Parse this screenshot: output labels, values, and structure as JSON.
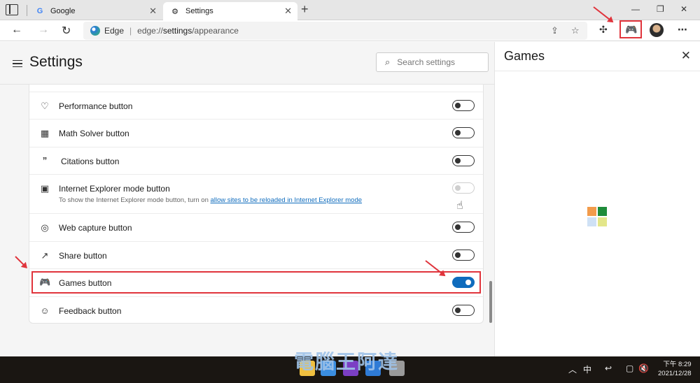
{
  "tabs": [
    {
      "label": "Google",
      "favicon": "google-icon"
    },
    {
      "label": "Settings",
      "favicon": "gear-icon"
    }
  ],
  "address": {
    "brand": "Edge",
    "url_prefix": "edge://",
    "url_host": "settings",
    "url_path": "/appearance"
  },
  "settings": {
    "title": "Settings",
    "search_placeholder": "Search settings",
    "rows": [
      {
        "icon": "heart-pulse-icon",
        "label": "Performance button",
        "state": "off"
      },
      {
        "icon": "calculator-icon",
        "label": "Math Solver button",
        "state": "off"
      },
      {
        "icon": "quote-icon",
        "label": "Citations button",
        "state": "off"
      },
      {
        "icon": "ie-mode-icon",
        "label": "Internet Explorer mode button",
        "state": "disabled",
        "sub_prefix": "To show the Internet Explorer mode button, turn on ",
        "sub_link": "allow sites to be reloaded in Internet Explorer mode"
      },
      {
        "icon": "web-capture-icon",
        "label": "Web capture button",
        "state": "off"
      },
      {
        "icon": "share-icon",
        "label": "Share button",
        "state": "off"
      },
      {
        "icon": "gamepad-icon",
        "label": "Games button",
        "state": "on"
      },
      {
        "icon": "feedback-icon",
        "label": "Feedback button",
        "state": "off"
      }
    ]
  },
  "games_pane": {
    "title": "Games",
    "logo_colors": [
      "#f29b4b",
      "#1e8c3a",
      "#cfe1f5",
      "#e3e68a"
    ]
  },
  "taskbar": {
    "ime_label": "中",
    "clock_period": "下午",
    "clock_time": "8:29",
    "clock_date": "2021/12/28"
  },
  "colors": {
    "accent": "#0f6cbd",
    "highlight": "#e0343c"
  }
}
